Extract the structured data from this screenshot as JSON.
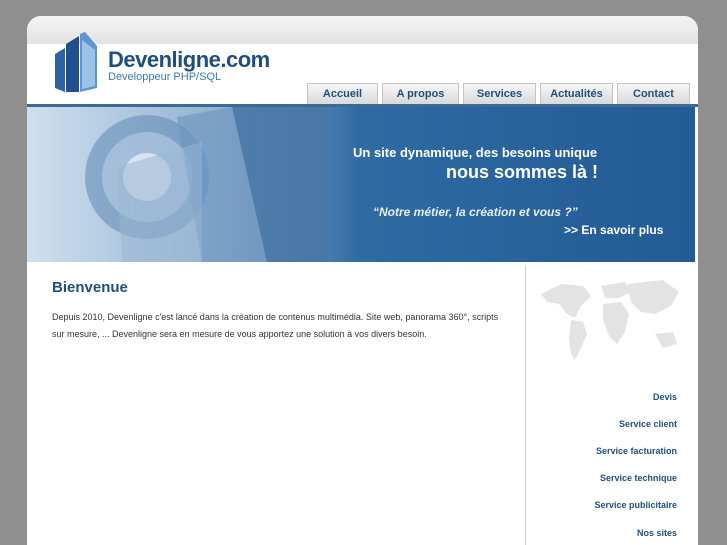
{
  "brand": {
    "name": "Devenligne.com",
    "tagline": "Developpeur PHP/SQL"
  },
  "nav": {
    "items": [
      {
        "label": "Accueil"
      },
      {
        "label": "A propos"
      },
      {
        "label": "Services"
      },
      {
        "label": "Actualités"
      },
      {
        "label": "Contact"
      }
    ]
  },
  "banner": {
    "line1": "Un site dynamique, des besoins unique",
    "line2": "nous sommes là !",
    "quote": "“Notre métier, la création et vous ?”",
    "cta": ">>  En savoir plus"
  },
  "main": {
    "title": "Bienvenue",
    "body": "Depuis 2010, Devenligne c'est lancé dans la création de contenus multimédia. Site web, panorama 360°, scripts sur mesure, ... Devenligne sera en mesure de vous apportez une solution à vos divers besoin."
  },
  "sidebar": {
    "links": [
      {
        "label": "Devis"
      },
      {
        "label": "Service client"
      },
      {
        "label": "Service facturation"
      },
      {
        "label": "Service technique"
      },
      {
        "label": "Service publicitaire"
      },
      {
        "label": "Nos sites"
      }
    ]
  },
  "colors": {
    "accent": "#1f4f7d",
    "banner": "#2f6aa3",
    "background": "#8f8f8f"
  },
  "icons": {
    "logo": "glass-towers-logo-icon",
    "map": "world-map-icon"
  }
}
